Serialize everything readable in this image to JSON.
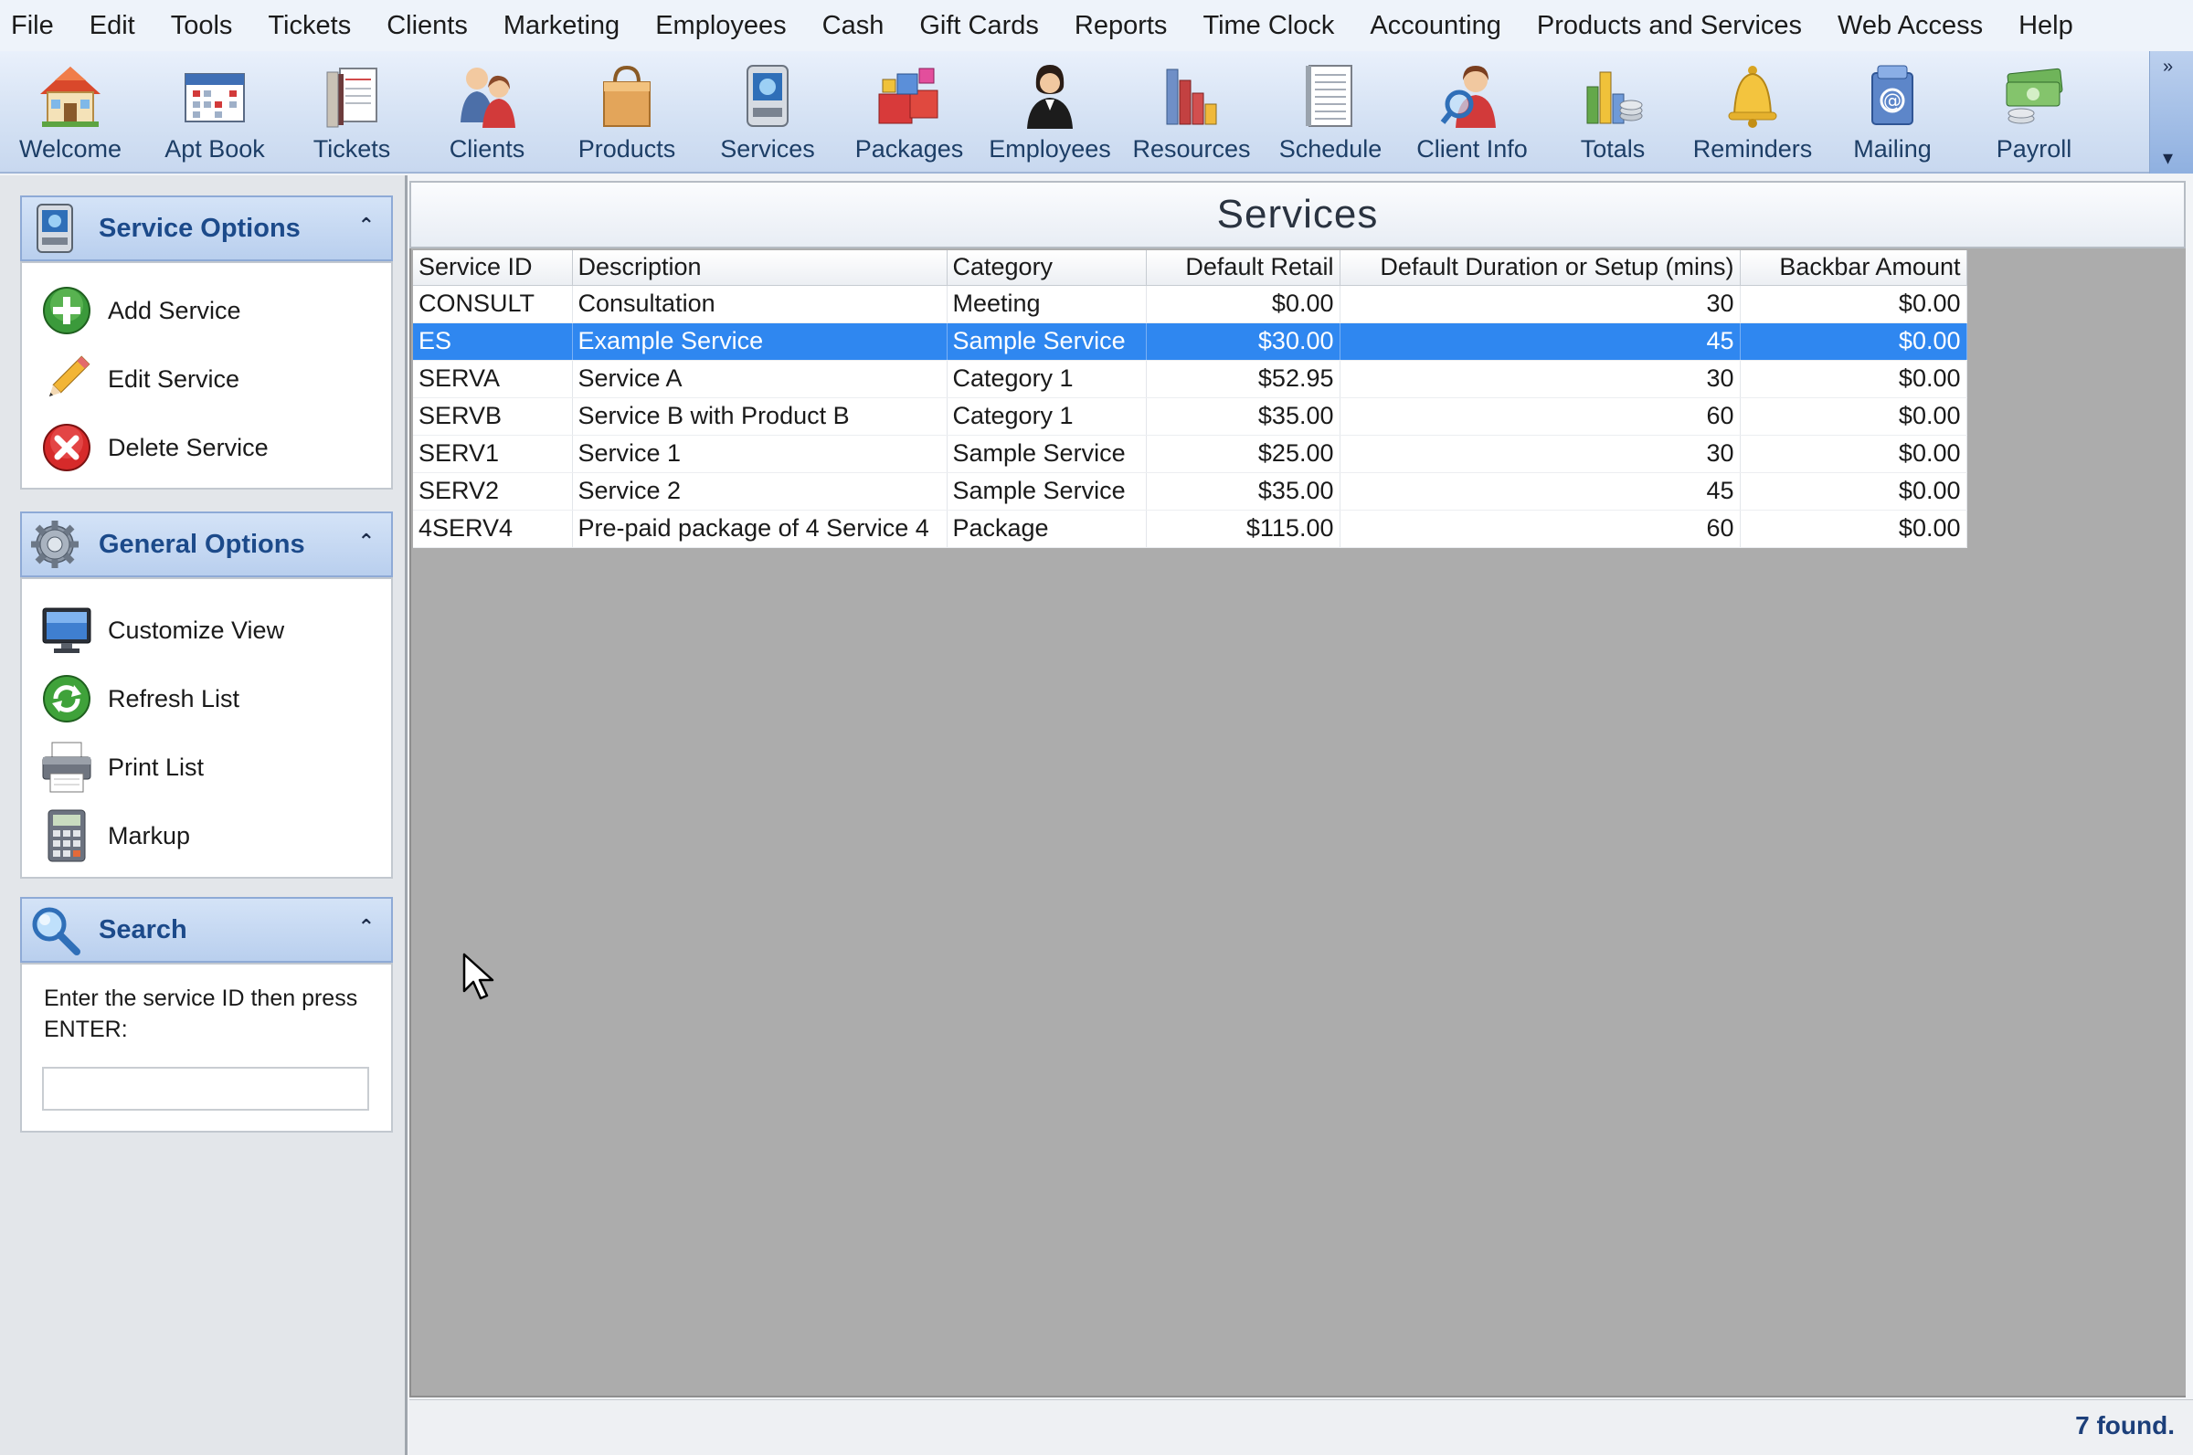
{
  "menu": [
    "File",
    "Edit",
    "Tools",
    "Tickets",
    "Clients",
    "Marketing",
    "Employees",
    "Cash",
    "Gift Cards",
    "Reports",
    "Time Clock",
    "Accounting",
    "Products and Services",
    "Web Access",
    "Help"
  ],
  "toolbar": {
    "buttons": [
      {
        "label": "Welcome",
        "icon": "house-icon"
      },
      {
        "label": "Apt Book",
        "icon": "calendar-icon"
      },
      {
        "label": "Tickets",
        "icon": "tickets-icon"
      },
      {
        "label": "Clients",
        "icon": "clients-icon"
      },
      {
        "label": "Products",
        "icon": "shopping-bag-icon"
      },
      {
        "label": "Services",
        "icon": "services-icon"
      },
      {
        "label": "Packages",
        "icon": "packages-icon"
      },
      {
        "label": "Employees",
        "icon": "employee-icon"
      },
      {
        "label": "Resources",
        "icon": "resources-icon"
      },
      {
        "label": "Schedule",
        "icon": "schedule-icon"
      },
      {
        "label": "Client Info",
        "icon": "client-info-icon"
      },
      {
        "label": "Totals",
        "icon": "totals-icon"
      },
      {
        "label": "Reminders",
        "icon": "bell-icon"
      },
      {
        "label": "Mailing",
        "icon": "mailing-icon"
      },
      {
        "label": "Payroll",
        "icon": "money-icon"
      }
    ],
    "overflow_top": "»",
    "overflow_bottom": "▾"
  },
  "left_pane": {
    "service_options": {
      "title": "Service Options",
      "collapse": "⌃",
      "items": [
        {
          "label": "Add Service",
          "icon": "add-icon"
        },
        {
          "label": "Edit Service",
          "icon": "pencil-icon"
        },
        {
          "label": "Delete Service",
          "icon": "delete-icon"
        }
      ]
    },
    "general_options": {
      "title": "General Options",
      "collapse": "⌃",
      "items": [
        {
          "label": "Customize View",
          "icon": "monitor-icon"
        },
        {
          "label": "Refresh List",
          "icon": "refresh-icon"
        },
        {
          "label": "Print List",
          "icon": "printer-icon"
        },
        {
          "label": "Markup",
          "icon": "calculator-icon"
        }
      ]
    },
    "search": {
      "title": "Search",
      "collapse": "⌃",
      "hint": "Enter the service ID then press ENTER:",
      "value": "",
      "placeholder": ""
    }
  },
  "main": {
    "title": "Services",
    "columns": [
      "Service ID",
      "Description",
      "Category",
      "Default Retail",
      "Default Duration or Setup (mins)",
      "Backbar Amount"
    ],
    "rows": [
      {
        "id": "CONSULT",
        "description": "Consultation",
        "category": "Meeting",
        "retail": "$0.00",
        "duration": "30",
        "backbar": "$0.00",
        "selected": false
      },
      {
        "id": "ES",
        "description": "Example Service",
        "category": "Sample Service",
        "retail": "$30.00",
        "duration": "45",
        "backbar": "$0.00",
        "selected": true
      },
      {
        "id": "SERVA",
        "description": "Service A",
        "category": "Category 1",
        "retail": "$52.95",
        "duration": "30",
        "backbar": "$0.00",
        "selected": false
      },
      {
        "id": "SERVB",
        "description": "Service B with Product B",
        "category": "Category 1",
        "retail": "$35.00",
        "duration": "60",
        "backbar": "$0.00",
        "selected": false
      },
      {
        "id": "SERV1",
        "description": "Service 1",
        "category": "Sample Service",
        "retail": "$25.00",
        "duration": "30",
        "backbar": "$0.00",
        "selected": false
      },
      {
        "id": "SERV2",
        "description": "Service 2",
        "category": "Sample Service",
        "retail": "$35.00",
        "duration": "45",
        "backbar": "$0.00",
        "selected": false
      },
      {
        "id": "4SERV4",
        "description": "Pre-paid package of 4 Service 4",
        "category": "Package",
        "retail": "$115.00",
        "duration": "60",
        "backbar": "$0.00",
        "selected": false
      }
    ]
  },
  "status": {
    "count": "7 found."
  },
  "colors": {
    "selection": "#2f87f0",
    "header_text": "#1c4a8a",
    "grid_background": "#acacac"
  }
}
